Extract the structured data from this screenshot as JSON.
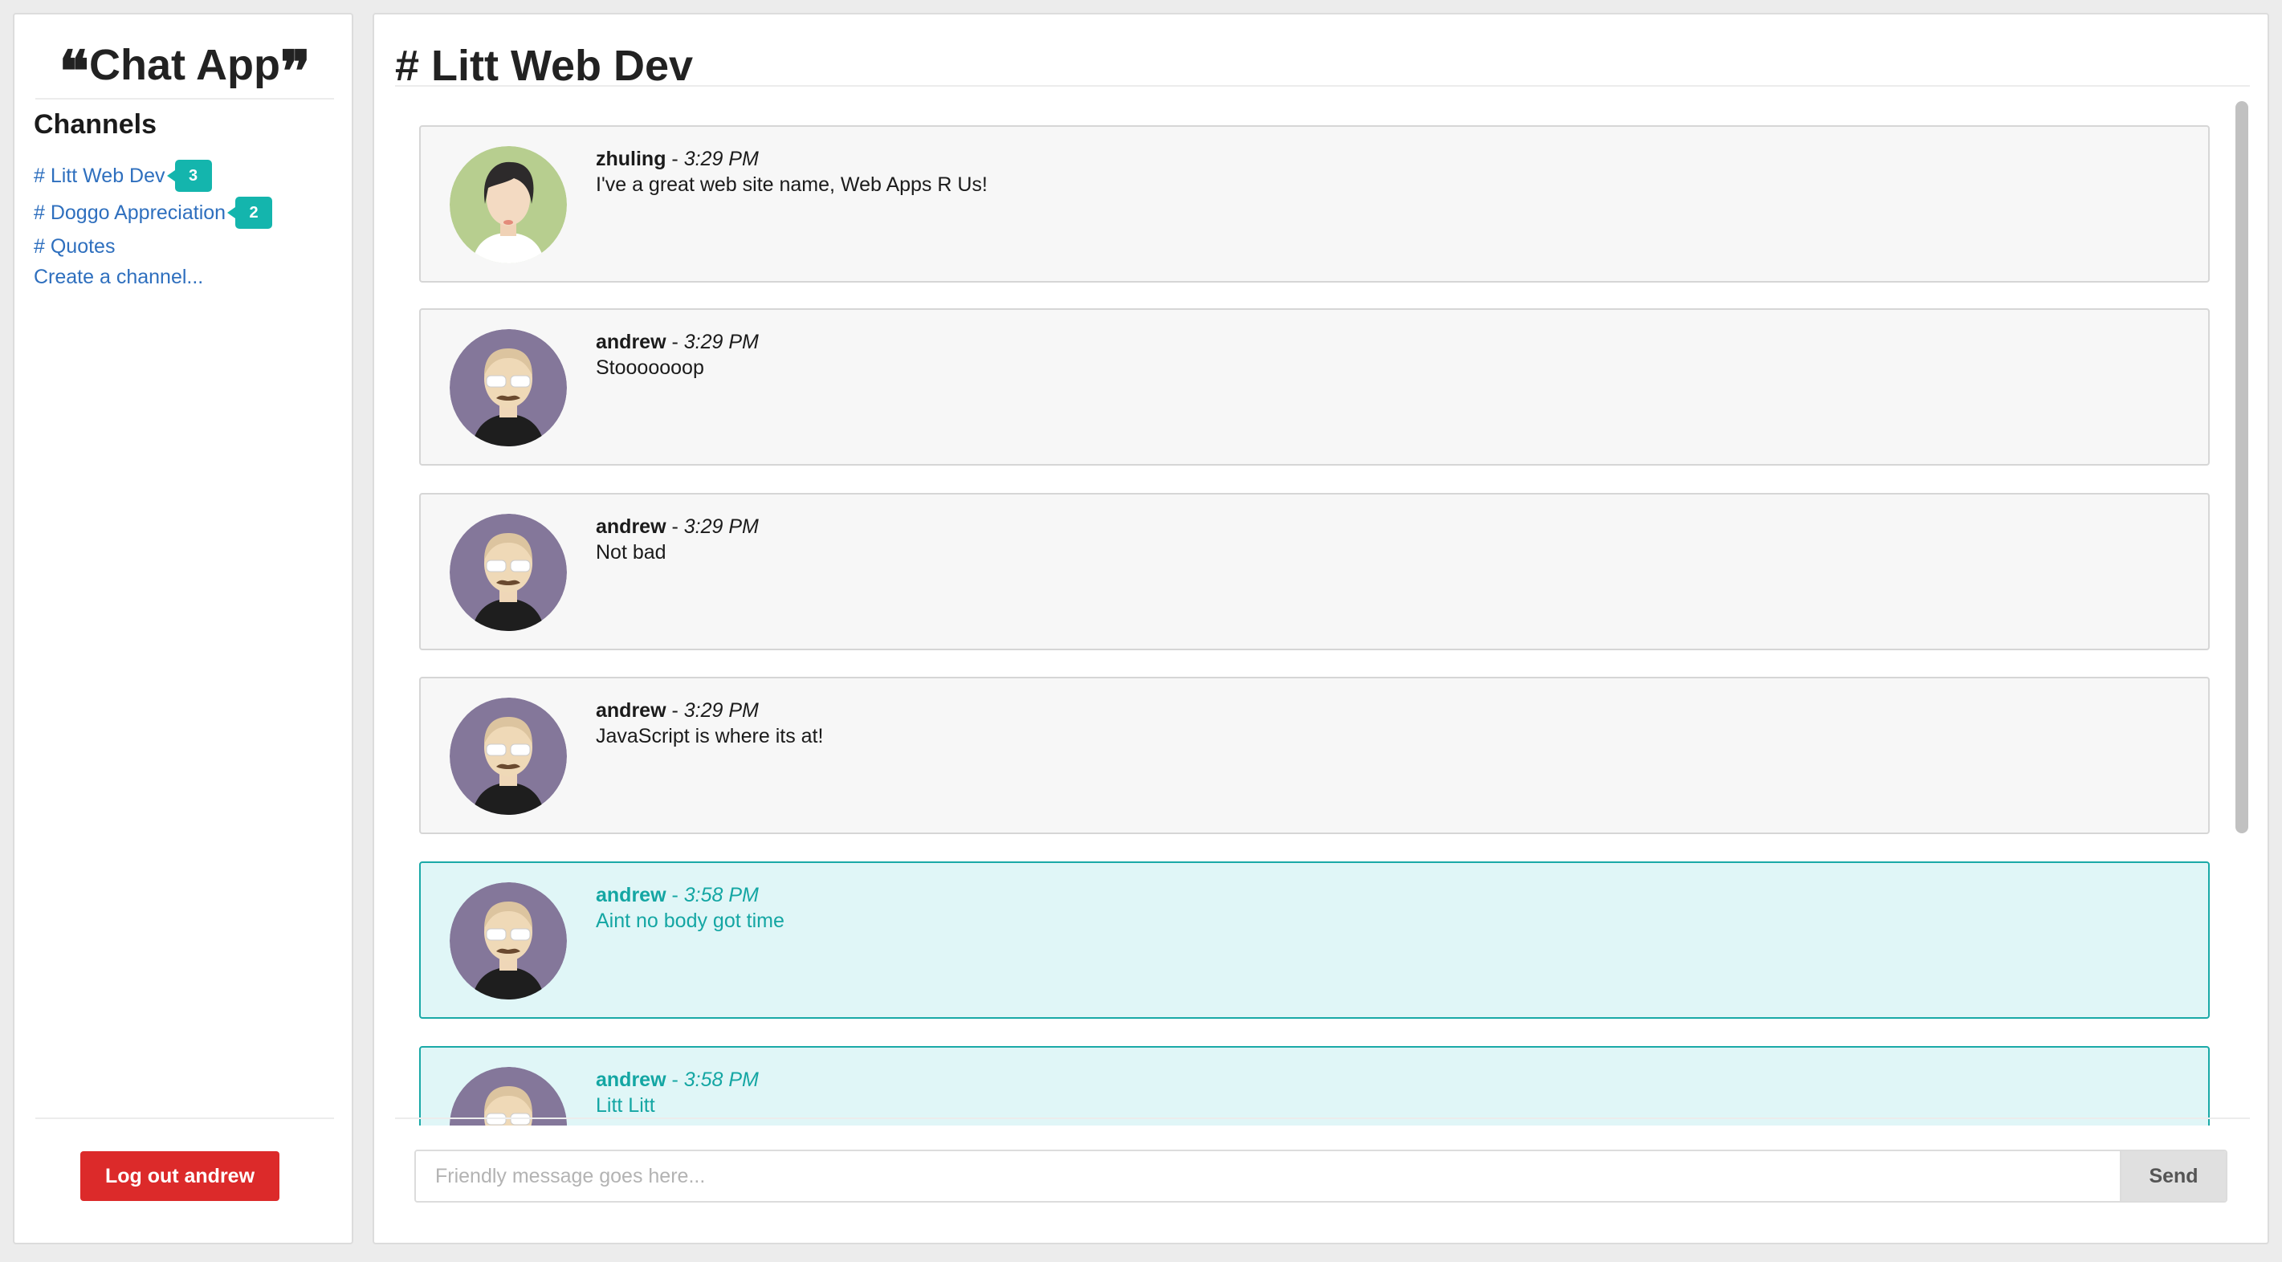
{
  "app": {
    "title": "Chat App",
    "open_quote": "❝",
    "close_quote": "❞"
  },
  "sidebar": {
    "heading": "Channels",
    "channels": [
      {
        "label": "# Litt Web Dev",
        "badge": "3"
      },
      {
        "label": "# Doggo Appreciation",
        "badge": "2"
      },
      {
        "label": "# Quotes"
      }
    ],
    "create_label": "Create a channel...",
    "logout_label": "Log out andrew"
  },
  "main": {
    "title": "# Litt Web Dev",
    "messages": [
      {
        "author": "zhuling",
        "separator": " - ",
        "time": "3:29 PM",
        "text": "I've a great web site name, Web Apps R Us!",
        "avatar": "female-avatar",
        "mine": false
      },
      {
        "author": "andrew",
        "separator": " - ",
        "time": "3:29 PM",
        "text": "Stooooooop",
        "avatar": "male-avatar",
        "mine": false
      },
      {
        "author": "andrew",
        "separator": " - ",
        "time": "3:29 PM",
        "text": "Not bad",
        "avatar": "male-avatar",
        "mine": false
      },
      {
        "author": "andrew",
        "separator": " - ",
        "time": "3:29 PM",
        "text": "JavaScript is where its at!",
        "avatar": "male-avatar",
        "mine": false
      },
      {
        "author": "andrew",
        "separator": " - ",
        "time": "3:58 PM",
        "text": "Aint no body got time",
        "avatar": "male-avatar",
        "mine": true
      },
      {
        "author": "andrew",
        "separator": " - ",
        "time": "3:58 PM",
        "text": "Litt Litt",
        "avatar": "male-avatar",
        "mine": true
      }
    ],
    "composer": {
      "placeholder": "Friendly message goes here...",
      "value": "",
      "send_label": "Send"
    }
  },
  "colors": {
    "accent": "#14b5ad",
    "logout": "#dc2a2a",
    "link": "#2e6fbe",
    "own_message_bg": "#e0f6f7"
  }
}
